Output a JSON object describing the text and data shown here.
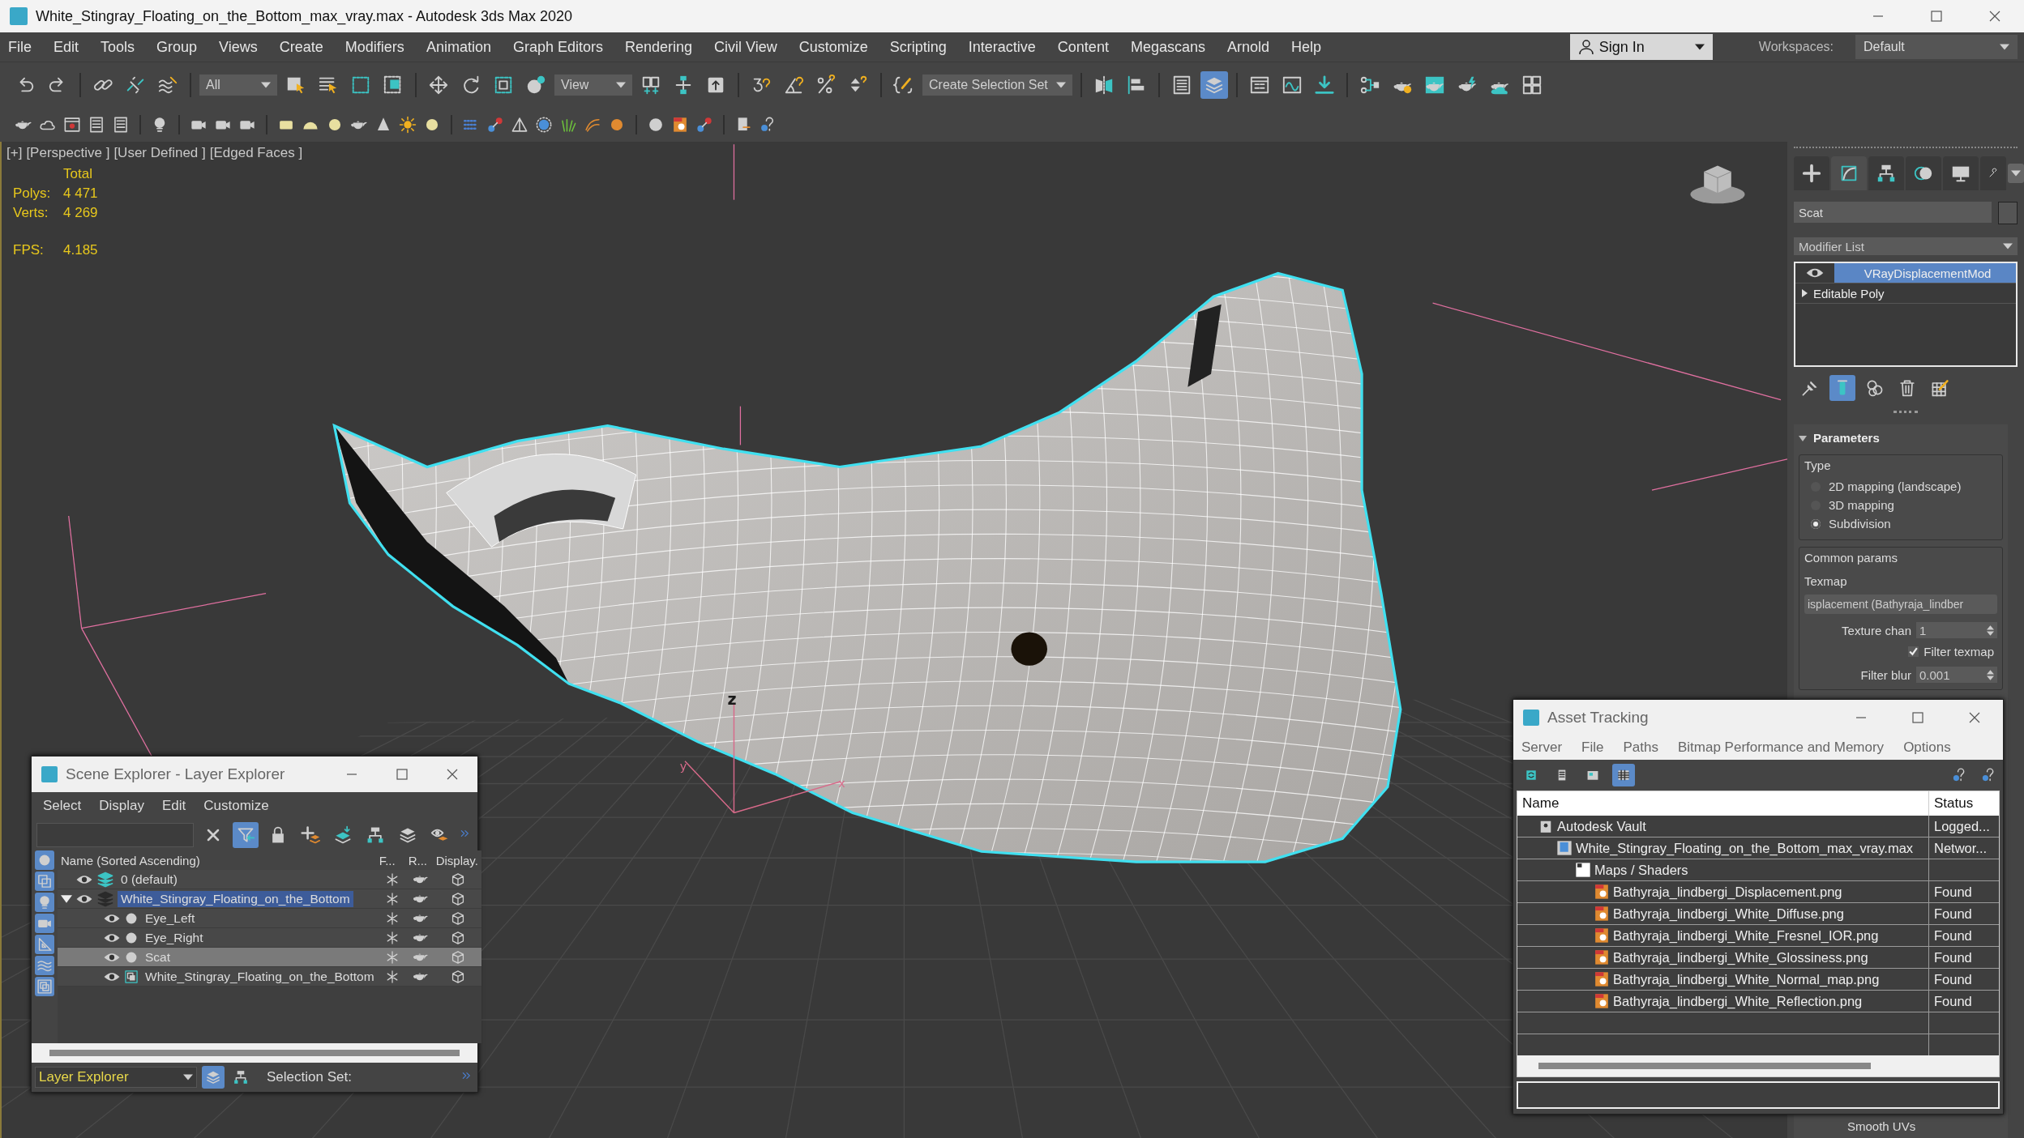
{
  "window": {
    "title": "White_Stingray_Floating_on_the_Bottom_max_vray.max - Autodesk 3ds Max 2020"
  },
  "menu": [
    "File",
    "Edit",
    "Tools",
    "Group",
    "Views",
    "Create",
    "Modifiers",
    "Animation",
    "Graph Editors",
    "Rendering",
    "Civil View",
    "Customize",
    "Scripting",
    "Interactive",
    "Content",
    "Megascans",
    "Arnold",
    "Help"
  ],
  "sign_in": "Sign In",
  "workspaces": {
    "label": "Workspaces:",
    "value": "Default"
  },
  "main_toolbar": [
    {
      "kind": "undo",
      "selected": false
    },
    {
      "kind": "redo",
      "selected": false
    },
    {
      "kind": "separator"
    },
    {
      "kind": "link",
      "selected": false
    },
    {
      "kind": "unlink",
      "selected": false
    },
    {
      "kind": "bind",
      "selected": false
    },
    {
      "kind": "separator"
    },
    {
      "kind": "dropdown",
      "value": "All"
    },
    {
      "kind": "select",
      "selected": false
    },
    {
      "kind": "namesel",
      "selected": false
    },
    {
      "kind": "region",
      "selected": false
    },
    {
      "kind": "crossing",
      "selected": false
    },
    {
      "kind": "separator"
    },
    {
      "kind": "move",
      "selected": false
    },
    {
      "kind": "rotate",
      "selected": false
    },
    {
      "kind": "scale",
      "selected": false
    },
    {
      "kind": "place",
      "selected": false
    },
    {
      "kind": "dropdown",
      "value": "View"
    },
    {
      "kind": "pivot",
      "selected": false
    },
    {
      "kind": "manip",
      "selected": false
    },
    {
      "kind": "keyboard",
      "selected": false
    },
    {
      "kind": "separator"
    },
    {
      "kind": "snap",
      "selected": false
    },
    {
      "kind": "anglesnap",
      "selected": false
    },
    {
      "kind": "percent",
      "selected": false
    },
    {
      "kind": "spinsnap",
      "selected": false
    },
    {
      "kind": "separator"
    },
    {
      "kind": "editsel",
      "selected": false
    },
    {
      "kind": "dropdown",
      "value": "Create Selection Set"
    },
    {
      "kind": "separator"
    },
    {
      "kind": "mirror",
      "selected": false
    },
    {
      "kind": "align",
      "selected": false
    },
    {
      "kind": "separator"
    },
    {
      "kind": "list",
      "selected": false
    },
    {
      "kind": "layers",
      "selected": true
    },
    {
      "kind": "separator"
    },
    {
      "kind": "ribbon",
      "selected": false
    },
    {
      "kind": "curve",
      "selected": false
    },
    {
      "kind": "download",
      "selected": false
    },
    {
      "kind": "separator"
    },
    {
      "kind": "schematic",
      "selected": false
    },
    {
      "kind": "teapotgear",
      "selected": false
    },
    {
      "kind": "teapotframe",
      "selected": false
    },
    {
      "kind": "teapotbolt",
      "selected": false
    },
    {
      "kind": "teapotcloud",
      "selected": false
    },
    {
      "kind": "imagegrid",
      "selected": false
    }
  ],
  "viewport": {
    "labels": [
      "[+]",
      "[Perspective ]",
      "[User Defined ]",
      "[Edged Faces ]"
    ],
    "stats": {
      "header": "Total",
      "rows": [
        {
          "label": "Polys:",
          "value": "4 471"
        },
        {
          "label": "Verts:",
          "value": "4 269"
        },
        {
          "label": "FPS:",
          "value": "4.185"
        }
      ]
    },
    "axis_labels": [
      "z",
      "y",
      "x"
    ]
  },
  "command_panel": {
    "tabs": [
      {
        "kind": "create",
        "selected": false
      },
      {
        "kind": "modify",
        "selected": true
      },
      {
        "kind": "hierarchy",
        "selected": false
      },
      {
        "kind": "motion",
        "selected": false
      },
      {
        "kind": "display",
        "selected": false
      },
      {
        "kind": "utilities",
        "selected": false
      }
    ],
    "object_name": "Scat",
    "modifier_list": "Modifier List",
    "stack": [
      {
        "name": "VRayDisplacementMod",
        "kind": "modifier",
        "enabled": true,
        "selected": true
      },
      {
        "name": "Editable Poly",
        "kind": "base",
        "expanded": false,
        "selected": false
      }
    ],
    "stack_tools": [
      {
        "kind": "pin",
        "selected": false
      },
      {
        "kind": "showresult",
        "selected": true
      },
      {
        "kind": "unique",
        "selected": false
      },
      {
        "kind": "remove",
        "selected": false
      },
      {
        "kind": "configure",
        "selected": false
      }
    ],
    "rollout": {
      "title": "Parameters",
      "expanded": true,
      "type_group": {
        "label": "Type",
        "options": [
          {
            "label": "2D mapping (landscape)",
            "selected": false
          },
          {
            "label": "3D mapping",
            "selected": false
          },
          {
            "label": "Subdivision",
            "selected": true
          }
        ]
      },
      "common": {
        "label": "Common params",
        "texmap_label": "Texmap",
        "texmap": "isplacement (Bathyraja_lindber",
        "texture_chan": {
          "label": "Texture chan",
          "value": "1"
        },
        "filter_texmap": {
          "label": "Filter texmap",
          "checked": true
        },
        "filter_blur": {
          "label": "Filter blur",
          "value": "0.001"
        },
        "smooth_uvs": {
          "label": "Smooth UVs"
        }
      }
    }
  },
  "scene_explorer": {
    "title": "Scene Explorer - Layer Explorer",
    "menu": [
      "Select",
      "Display",
      "Edit",
      "Customize"
    ],
    "toolbar": [
      {
        "kind": "clear",
        "selected": false
      },
      {
        "kind": "filter",
        "selected": true
      },
      {
        "kind": "lock",
        "selected": false
      },
      {
        "kind": "newlayer",
        "selected": false
      },
      {
        "kind": "addtolayer",
        "selected": false
      },
      {
        "kind": "hierarchy",
        "selected": false
      },
      {
        "kind": "layers",
        "selected": false
      },
      {
        "kind": "hide",
        "selected": false
      }
    ],
    "side_filters": [
      {
        "kind": "geometry",
        "selected": true
      },
      {
        "kind": "shapes",
        "selected": true
      },
      {
        "kind": "lights",
        "selected": true
      },
      {
        "kind": "cameras",
        "selected": true
      },
      {
        "kind": "helpers",
        "selected": true
      },
      {
        "kind": "spacewarps",
        "selected": true
      },
      {
        "kind": "groups",
        "selected": true
      }
    ],
    "columns": [
      "Name (Sorted Ascending)",
      "F...",
      "R...",
      "Display."
    ],
    "tree": [
      {
        "name": "0 (default)",
        "kind": "layer",
        "current": true,
        "selected": false
      },
      {
        "name": "White_Stingray_Floating_on_the_Bottom",
        "kind": "layer",
        "current": false,
        "selected": true,
        "expanded": true,
        "children": [
          {
            "name": "Eye_Left",
            "kind": "sphere",
            "selected": false
          },
          {
            "name": "Eye_Right",
            "kind": "sphere",
            "selected": false
          },
          {
            "name": "Scat",
            "kind": "sphere",
            "selected": true
          },
          {
            "name": "White_Stingray_Floating_on_the_Bottom",
            "kind": "mesh",
            "selected": false
          }
        ]
      }
    ],
    "explorer_type": "Layer Explorer",
    "footer_tools": [
      {
        "kind": "layers",
        "selected": true
      },
      {
        "kind": "hierarchy",
        "selected": false
      }
    ],
    "selection_set_label": "Selection Set:"
  },
  "asset_tracking": {
    "title": "Asset Tracking",
    "menu": [
      "Server",
      "File",
      "Paths",
      "Bitmap Performance and Memory",
      "Options"
    ],
    "toolbar": [
      {
        "kind": "refresh",
        "selected": false
      },
      {
        "kind": "listview",
        "selected": false
      },
      {
        "kind": "thumbs",
        "selected": false
      },
      {
        "kind": "table",
        "selected": true
      }
    ],
    "columns": [
      "Name",
      "Status"
    ],
    "tree": [
      {
        "name": "Autodesk Vault",
        "status": "Logged...",
        "kind": "vault",
        "children": [
          {
            "name": "White_Stingray_Floating_on_the_Bottom_max_vray.max",
            "status": "Networ...",
            "kind": "maxfile",
            "children": [
              {
                "name": "Maps / Shaders",
                "kind": "folder",
                "children": [
                  {
                    "name": "Bathyraja_lindbergi_Displacement.png",
                    "status": "Found",
                    "kind": "image"
                  },
                  {
                    "name": "Bathyraja_lindbergi_White_Diffuse.png",
                    "status": "Found",
                    "kind": "image"
                  },
                  {
                    "name": "Bathyraja_lindbergi_White_Fresnel_IOR.png",
                    "status": "Found",
                    "kind": "image"
                  },
                  {
                    "name": "Bathyraja_lindbergi_White_Glossiness.png",
                    "status": "Found",
                    "kind": "image"
                  },
                  {
                    "name": "Bathyraja_lindbergi_White_Normal_map.png",
                    "status": "Found",
                    "kind": "image"
                  },
                  {
                    "name": "Bathyraja_lindbergi_White_Reflection.png",
                    "status": "Found",
                    "kind": "image"
                  }
                ]
              }
            ]
          }
        ]
      }
    ]
  }
}
